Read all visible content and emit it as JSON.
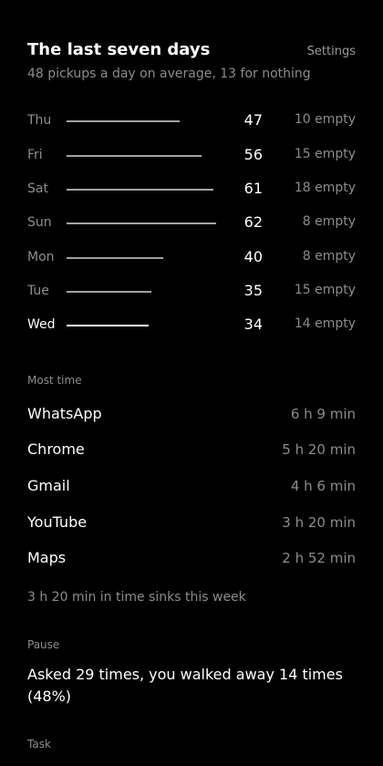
{
  "header": {
    "title": "The last seven days",
    "settings_label": "Settings",
    "subtitle": "48 pickups a day on average, 13 for nothing"
  },
  "days": [
    {
      "label": "Thu",
      "pickups": "47",
      "empty": "10 empty",
      "current": false
    },
    {
      "label": "Fri",
      "pickups": "56",
      "empty": "15 empty",
      "current": false
    },
    {
      "label": "Sat",
      "pickups": "61",
      "empty": "18 empty",
      "current": false
    },
    {
      "label": "Sun",
      "pickups": "62",
      "empty": "8 empty",
      "current": false
    },
    {
      "label": "Mon",
      "pickups": "40",
      "empty": "8 empty",
      "current": false
    },
    {
      "label": "Tue",
      "pickups": "35",
      "empty": "15 empty",
      "current": false
    },
    {
      "label": "Wed",
      "pickups": "34",
      "empty": "14 empty",
      "current": true
    }
  ],
  "most_time": {
    "label": "Most time",
    "apps": [
      {
        "name": "WhatsApp",
        "time": "6 h 9 min"
      },
      {
        "name": "Chrome",
        "time": "5 h 20 min"
      },
      {
        "name": "Gmail",
        "time": "4 h 6 min"
      },
      {
        "name": "YouTube",
        "time": "3 h 20 min"
      },
      {
        "name": "Maps",
        "time": "2 h 52 min"
      }
    ],
    "sinks_note": "3 h 20 min in time sinks this week"
  },
  "pause": {
    "label": "Pause",
    "text": "Asked 29 times, you walked away 14 times (48%)"
  },
  "task": {
    "label": "Task"
  },
  "colors": {
    "background": "#000000",
    "text_primary": "#ffffff",
    "text_secondary": "#8c8c8c",
    "bar": "#a3a3a3",
    "bar_current": "#ffffff"
  }
}
